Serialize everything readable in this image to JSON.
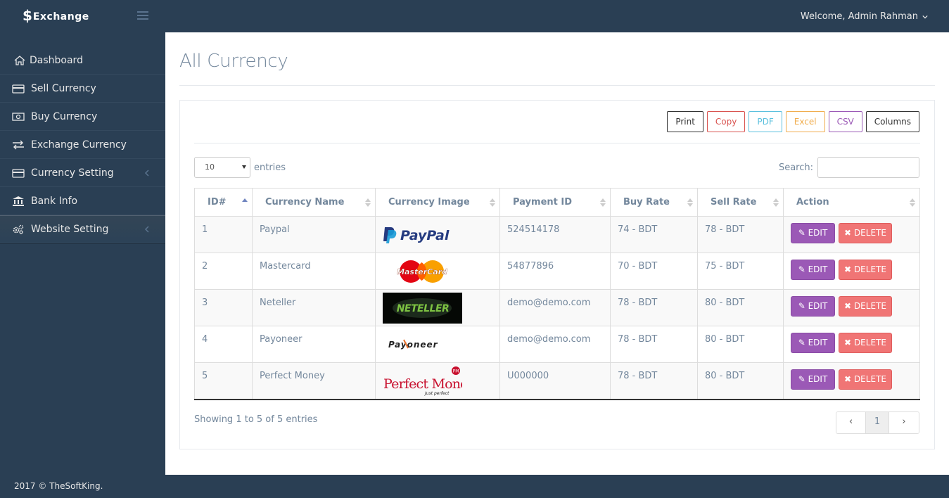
{
  "brand": {
    "symbol": "$",
    "name": "Exchange"
  },
  "header": {
    "welcome": "Welcome, Admin Rahman"
  },
  "sidebar": {
    "items": [
      {
        "label": "Dashboard",
        "icon": "home-icon"
      },
      {
        "label": "Sell Currency",
        "icon": "credit-card-icon"
      },
      {
        "label": "Buy Currency",
        "icon": "money-icon"
      },
      {
        "label": "Exchange Currency",
        "icon": "exchange-icon"
      },
      {
        "label": "Currency Setting",
        "icon": "credit-card-icon",
        "has_chevron": true
      },
      {
        "label": "Bank Info",
        "icon": "bank-icon"
      },
      {
        "label": "Website Setting",
        "icon": "gears-icon",
        "has_chevron": true,
        "active": true
      }
    ]
  },
  "footer": {
    "text": "2017 © TheSoftKing."
  },
  "page": {
    "title": "All Currency"
  },
  "toolbar": {
    "print": "Print",
    "copy": "Copy",
    "pdf": "PDF",
    "excel": "Excel",
    "csv": "CSV",
    "columns": "Columns"
  },
  "length": {
    "value": "10",
    "suffix": "entries"
  },
  "search": {
    "label": "Search:",
    "value": ""
  },
  "table": {
    "headers": {
      "id": "ID#",
      "name": "Currency Name",
      "image": "Currency Image",
      "payment": "Payment ID",
      "buy": "Buy Rate",
      "sell": "Sell Rate",
      "action": "Action"
    },
    "rows": [
      {
        "id": "1",
        "name": "Paypal",
        "logo": "PayPal",
        "payment": "524514178",
        "buy": "74 - BDT",
        "sell": "78 - BDT"
      },
      {
        "id": "2",
        "name": "Mastercard",
        "logo": "MasterCard",
        "payment": "54877896",
        "buy": "70 - BDT",
        "sell": "75 - BDT"
      },
      {
        "id": "3",
        "name": "Neteller",
        "logo": "NETELLER",
        "payment": "demo@demo.com",
        "buy": "78 - BDT",
        "sell": "80 - BDT"
      },
      {
        "id": "4",
        "name": "Payoneer",
        "logo": "Payoneer",
        "payment": "demo@demo.com",
        "buy": "78 - BDT",
        "sell": "80 - BDT"
      },
      {
        "id": "5",
        "name": "Perfect Money",
        "logo": "Perfect Money",
        "logo_sub": "Just perfect",
        "payment": "U000000",
        "buy": "78 - BDT",
        "sell": "80 - BDT"
      }
    ],
    "edit_label": "EDIT",
    "delete_label": "DELETE"
  },
  "info": {
    "text": "Showing 1 to 5 of 5 entries"
  },
  "pagination": {
    "prev": "‹",
    "current": "1",
    "next": "›"
  },
  "colors": {
    "sidebar_bg": "#2A3F54",
    "edit": "#9B59B6",
    "delete": "#f07575"
  }
}
